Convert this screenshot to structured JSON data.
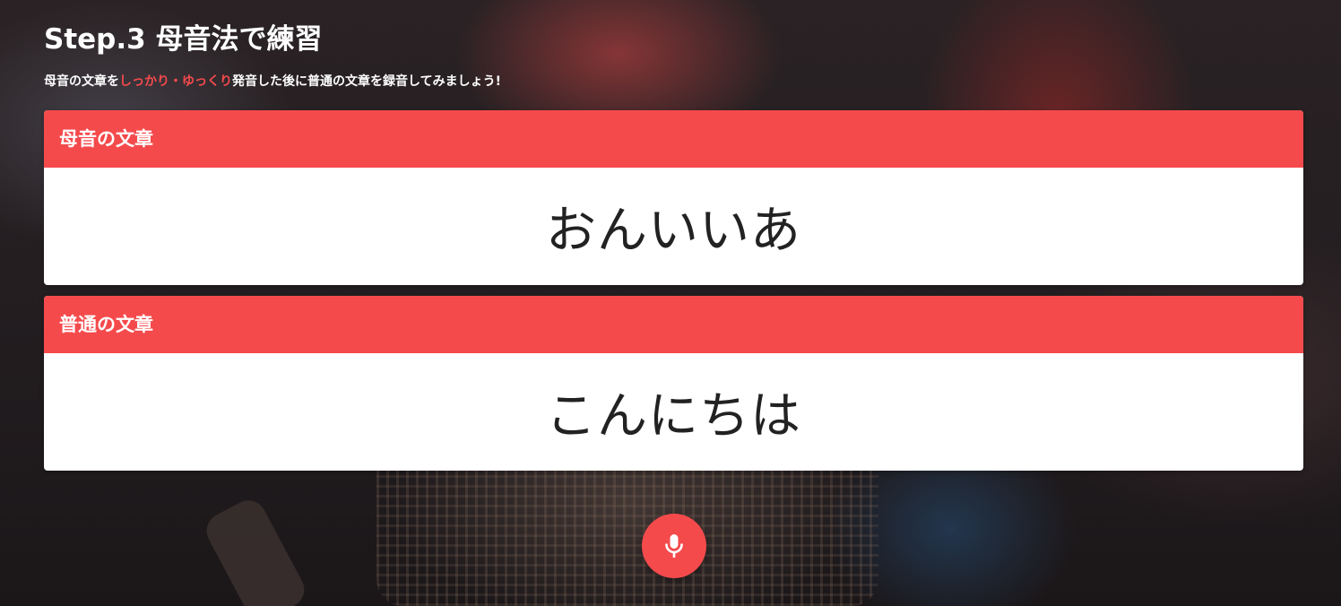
{
  "header": {
    "title": "Step.3 母音法で練習",
    "instruction_before": "母音の文章を",
    "instruction_accent": "しっかり・ゆっくり",
    "instruction_after": "発音した後に普通の文章を録音してみましょう!"
  },
  "cards": [
    {
      "label": "母音の文章",
      "text": "おんいいあ"
    },
    {
      "label": "普通の文章",
      "text": "こんにちは"
    }
  ],
  "record_button": {
    "icon": "microphone-icon"
  },
  "colors": {
    "accent": "#f54a4c",
    "card_background": "#ffffff",
    "phrase_text": "#222222"
  }
}
